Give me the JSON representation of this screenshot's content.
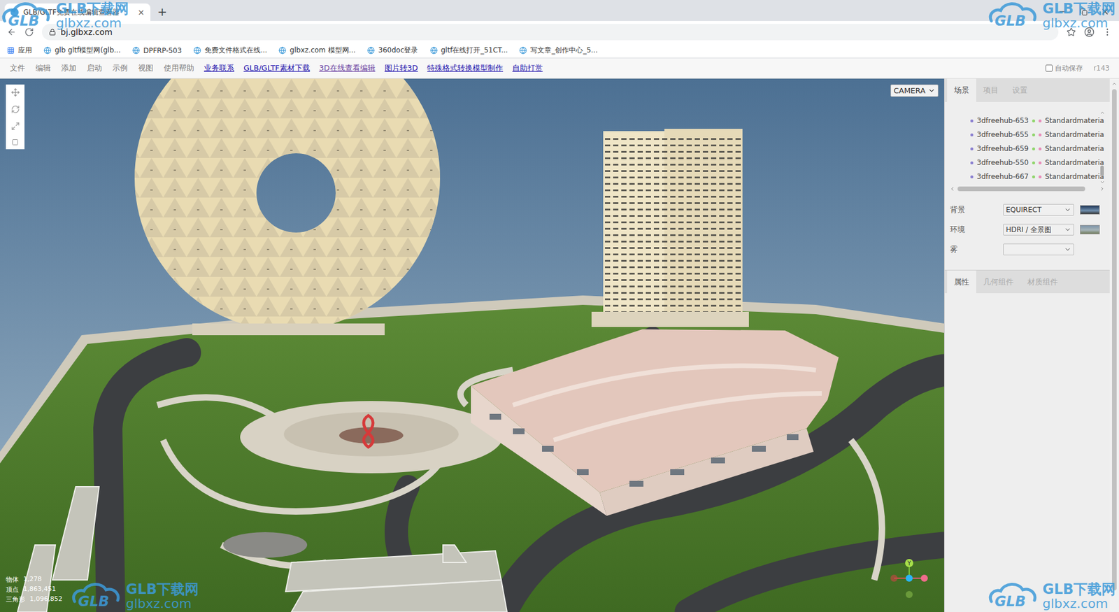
{
  "browser": {
    "tab": {
      "title": "GLB/GLTF免费在线编辑查看器",
      "close": "×"
    },
    "new_tab": "+",
    "url": "bj.glbxz.com",
    "bookmarks": [
      {
        "label": "应用",
        "kind": "apps"
      },
      {
        "label": "glb gltf模型网(glb...",
        "kind": "site"
      },
      {
        "label": "DPFRP-503",
        "kind": "site"
      },
      {
        "label": "免费文件格式在线...",
        "kind": "site"
      },
      {
        "label": "glbxz.com 模型网...",
        "kind": "site"
      },
      {
        "label": "360doc登录",
        "kind": "site"
      },
      {
        "label": "gltf在线打开_51CT...",
        "kind": "site"
      },
      {
        "label": "写文章_创作中心_5...",
        "kind": "site"
      }
    ]
  },
  "menu": {
    "items": [
      "文件",
      "编辑",
      "添加",
      "启动",
      "示例",
      "视图",
      "使用帮助"
    ],
    "links": [
      {
        "label": "业务联系",
        "visited": false
      },
      {
        "label": "GLB/GLTF素材下载",
        "visited": false
      },
      {
        "label": "3D在线查看编辑",
        "visited": true
      },
      {
        "label": "图片转3D",
        "visited": false
      },
      {
        "label": "特殊格式转换模型制作",
        "visited": false
      },
      {
        "label": "自助打赏",
        "visited": false
      }
    ],
    "autosave": {
      "label": "自动保存",
      "checked": false
    },
    "version": "r143"
  },
  "viewport": {
    "camera": "CAMERA",
    "stats": [
      {
        "label": "物体",
        "value": "1,278"
      },
      {
        "label": "顶点",
        "value": "1,863,451"
      },
      {
        "label": "三角形",
        "value": "1,096,852"
      }
    ],
    "axis_label": "Y"
  },
  "sidebar": {
    "tabs": [
      {
        "label": "场景",
        "selected": true
      },
      {
        "label": "项目",
        "selected": false
      },
      {
        "label": "设置",
        "selected": false
      }
    ],
    "outliner": [
      {
        "name": "3dfreehub-653",
        "material": "Standardmateria"
      },
      {
        "name": "3dfreehub-655",
        "material": "Standardmateria"
      },
      {
        "name": "3dfreehub-659",
        "material": "Standardmateria"
      },
      {
        "name": "3dfreehub-550",
        "material": "Standardmateria"
      },
      {
        "name": "3dfreehub-667",
        "material": "Standardmateria"
      }
    ],
    "properties": [
      {
        "label": "背景",
        "value": "EQUIRECT",
        "kind": "sky"
      },
      {
        "label": "环境",
        "value": "HDRI / 全景图",
        "kind": "hdri"
      },
      {
        "label": "雾",
        "value": "",
        "kind": "plain"
      }
    ],
    "panel_tabs": [
      {
        "label": "属性",
        "selected": true
      },
      {
        "label": "几何组件",
        "selected": false
      },
      {
        "label": "材质组件",
        "selected": false
      }
    ]
  },
  "watermark": {
    "logo": "GLB",
    "title": "GLB下载网",
    "url": "glbxz.com"
  }
}
